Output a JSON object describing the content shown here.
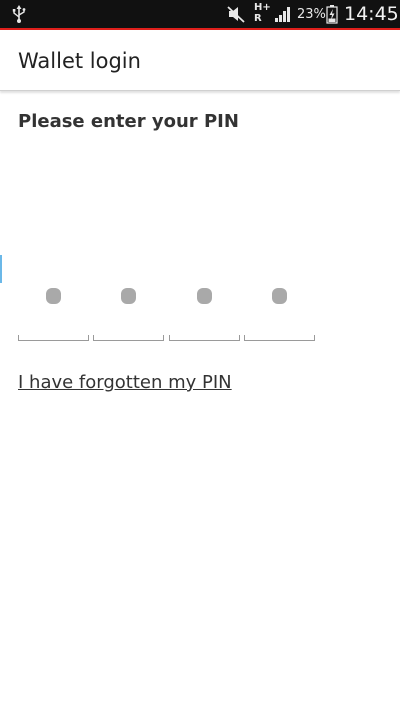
{
  "status_bar": {
    "network_label": "H+ R",
    "battery_percent": "23%",
    "time": "14:45",
    "icons": [
      "usb-icon",
      "mute-icon",
      "signal-icon",
      "battery-icon"
    ],
    "accent_color": "#e0201c"
  },
  "action_bar": {
    "title": "Wallet login"
  },
  "login": {
    "prompt": "Please enter your PIN",
    "pin_length": 4,
    "pin_filled": 4,
    "forgot_link": "I have forgotten my PIN"
  }
}
